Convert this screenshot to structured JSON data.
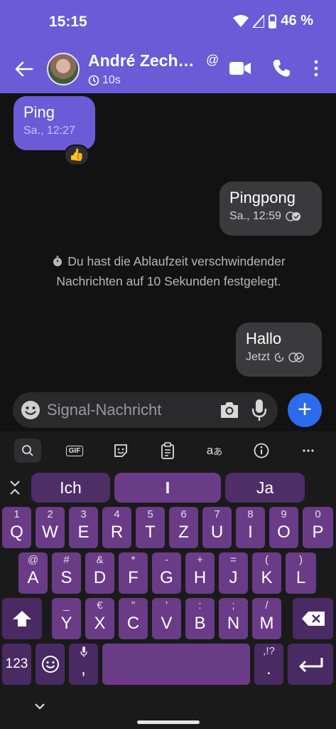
{
  "status_bar": {
    "time": "15:15",
    "battery": "46 %"
  },
  "app_bar": {
    "contact_name": "André Zech…",
    "disappearing_timer": "10s"
  },
  "messages": [
    {
      "text": "Ping",
      "time": "Sa., 12:27",
      "reaction": "👍"
    },
    {
      "text": "Pingpong",
      "time": "Sa., 12:59"
    },
    {
      "text": "Hallo",
      "time": "Jetzt"
    }
  ],
  "system_message": "Du hast die Ablaufzeit verschwindender Nachrichten auf 10 Sekunden festgelegt.",
  "composer": {
    "placeholder": "Signal-Nachricht",
    "send_label": "+"
  },
  "keyboard": {
    "tools": {
      "gif": "GIF"
    },
    "suggestions": [
      "Ich",
      "I",
      "Ja"
    ],
    "row1": [
      {
        "main": "Q",
        "hint": "1"
      },
      {
        "main": "W",
        "hint": "2"
      },
      {
        "main": "E",
        "hint": "3"
      },
      {
        "main": "R",
        "hint": "4"
      },
      {
        "main": "T",
        "hint": "5"
      },
      {
        "main": "Z",
        "hint": "6"
      },
      {
        "main": "U",
        "hint": "7"
      },
      {
        "main": "I",
        "hint": "8"
      },
      {
        "main": "O",
        "hint": "9"
      },
      {
        "main": "P",
        "hint": "0"
      }
    ],
    "row2": [
      {
        "main": "A",
        "hint": "@"
      },
      {
        "main": "S",
        "hint": "#"
      },
      {
        "main": "D",
        "hint": "&"
      },
      {
        "main": "F",
        "hint": "*"
      },
      {
        "main": "G",
        "hint": "-"
      },
      {
        "main": "H",
        "hint": "+"
      },
      {
        "main": "J",
        "hint": "="
      },
      {
        "main": "K",
        "hint": "("
      },
      {
        "main": "L",
        "hint": ")"
      }
    ],
    "row3": [
      {
        "main": "Y",
        "hint": "_"
      },
      {
        "main": "X",
        "hint": "€"
      },
      {
        "main": "C",
        "hint": "\""
      },
      {
        "main": "V",
        "hint": "'"
      },
      {
        "main": "B",
        "hint": ":"
      },
      {
        "main": "N",
        "hint": ";"
      },
      {
        "main": "M",
        "hint": "/"
      }
    ],
    "numbers_key": "123",
    "comma_key": ",",
    "period_key": ".",
    "period_hint": ",!?"
  },
  "colors": {
    "header": "#6b5bd6",
    "key": "#6a3b87",
    "send": "#2c6bed"
  }
}
